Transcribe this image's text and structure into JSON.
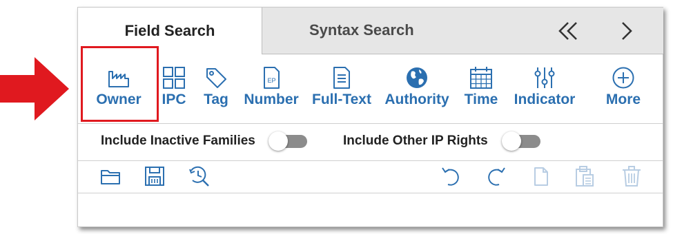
{
  "tabs": [
    {
      "label": "Field Search",
      "active": true
    },
    {
      "label": "Syntax Search",
      "active": false
    }
  ],
  "tab_nav": {
    "prev_icon": "double-chevron-left-icon",
    "next_icon": "chevron-right-icon"
  },
  "categories": [
    {
      "label": "Owner",
      "icon": "factory-icon",
      "highlighted": true
    },
    {
      "label": "IPC",
      "icon": "grid-icon"
    },
    {
      "label": "Tag",
      "icon": "tag-icon"
    },
    {
      "label": "Number",
      "icon": "document-ep-icon",
      "icon_text": "EP"
    },
    {
      "label": "Full-Text",
      "icon": "text-document-icon"
    },
    {
      "label": "Authority",
      "icon": "globe-icon"
    },
    {
      "label": "Time",
      "icon": "calendar-icon"
    },
    {
      "label": "Indicator",
      "icon": "sliders-icon"
    },
    {
      "label": "More",
      "icon": "plus-circle-icon"
    }
  ],
  "toggles": [
    {
      "label": "Include Inactive Families",
      "state": "off"
    },
    {
      "label": "Include Other IP Rights",
      "state": "off"
    }
  ],
  "actions_left": [
    "folder-open-icon",
    "save-icon",
    "history-search-icon"
  ],
  "actions_right": [
    "undo-icon",
    "redo-icon",
    "copy-icon",
    "paste-icon",
    "delete-icon"
  ],
  "colors": {
    "accent": "#2b6fb0",
    "highlight": "#e0191f",
    "arrow": "#e0191f",
    "inactive_tab": "#e6e6e6",
    "toggle_off": "#8c8c8c",
    "disabled_icon": "#b8cde3"
  }
}
